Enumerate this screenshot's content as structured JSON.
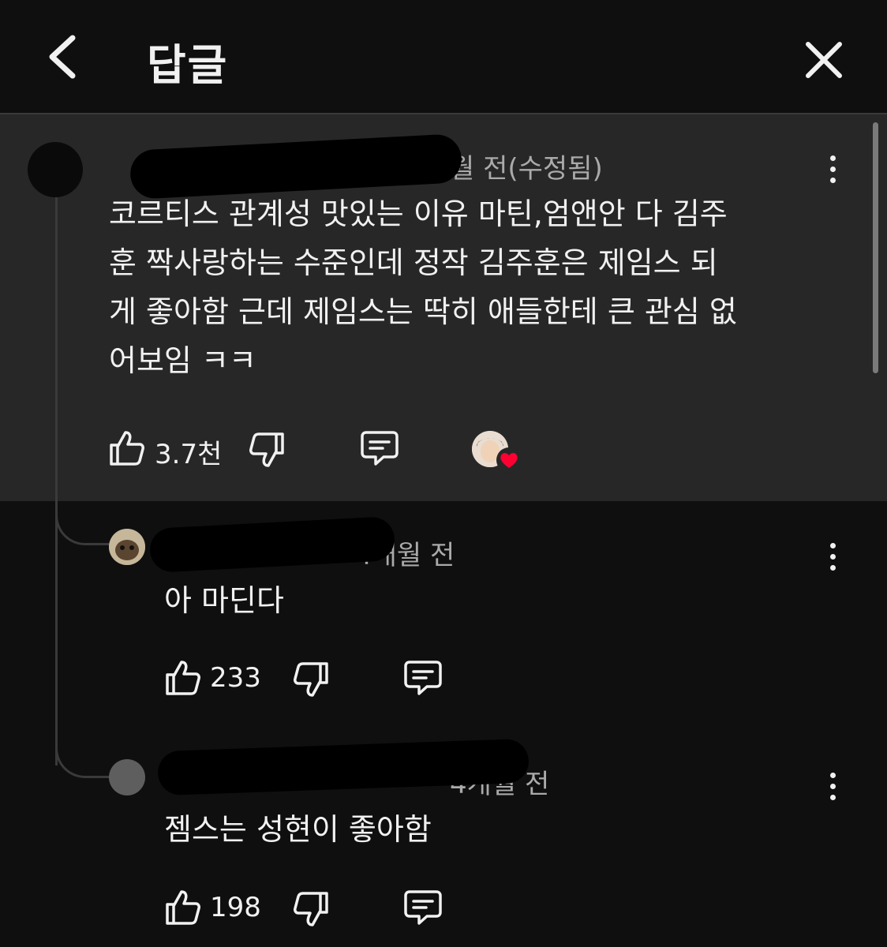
{
  "header": {
    "title": "답글"
  },
  "icons": {
    "back": "chevron-left-icon",
    "close": "close-icon"
  },
  "colors": {
    "background": "#0f0f0f",
    "highlight": "#272727",
    "heart": "#ff0033"
  },
  "parent_comment": {
    "meta": "월 전(수정됨)",
    "text_lines": [
      "코르티스 관계성 맛있는 이유 마틴,엄앤안 다 김주",
      "훈 짝사랑하는 수준인데 정작 김주훈은 제임스 되",
      "게 좋아함 근데 제임스는 딱히 애들한테 큰 관심 없",
      "어보임 ㅋㅋ"
    ],
    "like_count": "3.7천"
  },
  "replies": [
    {
      "meta": "4개월 전",
      "text": "아 마딘다",
      "like_count": "233"
    },
    {
      "meta": "4개월 전",
      "text": "젬스는 성현이 좋아함",
      "like_count": "198"
    }
  ]
}
